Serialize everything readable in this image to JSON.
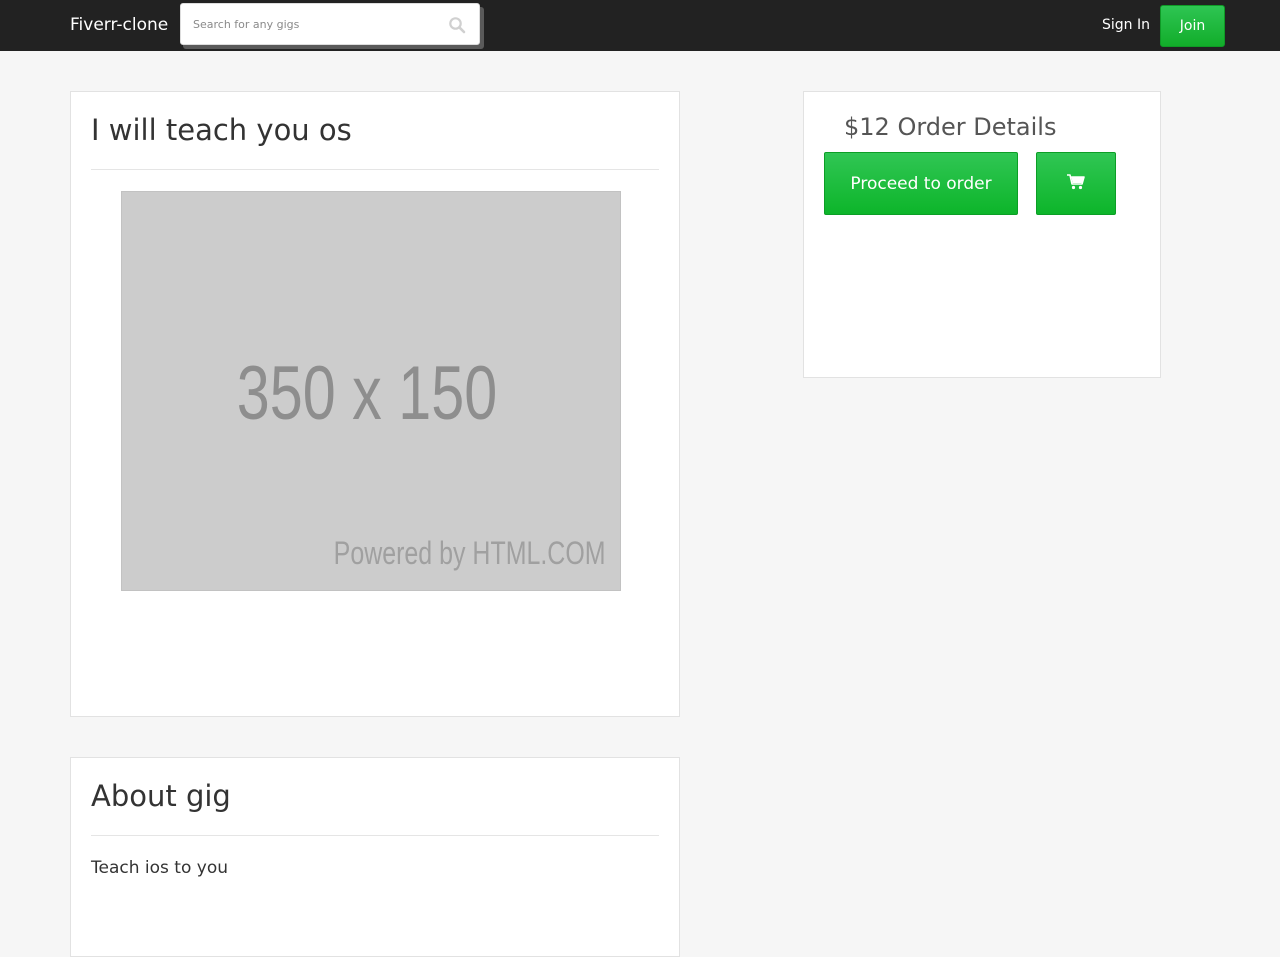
{
  "navbar": {
    "brand": "Fiverr-clone",
    "search": {
      "placeholder": "Search for any gigs",
      "value": "",
      "icon": "search-icon"
    },
    "signin_label": "Sign In",
    "join_label": "Join"
  },
  "gig": {
    "title": "I will teach you os",
    "image": {
      "size_text": "350 x 150",
      "powered_text": "Powered by HTML.COM"
    }
  },
  "order": {
    "title": "$12 Order Details",
    "proceed_label": "Proceed to order",
    "cart_icon": "shopping-cart-icon"
  },
  "about": {
    "title": "About gig",
    "text": "Teach ios to you"
  },
  "colors": {
    "navbar_bg": "#222222",
    "page_bg": "#f6f6f6",
    "accent_green": "#1db954"
  }
}
